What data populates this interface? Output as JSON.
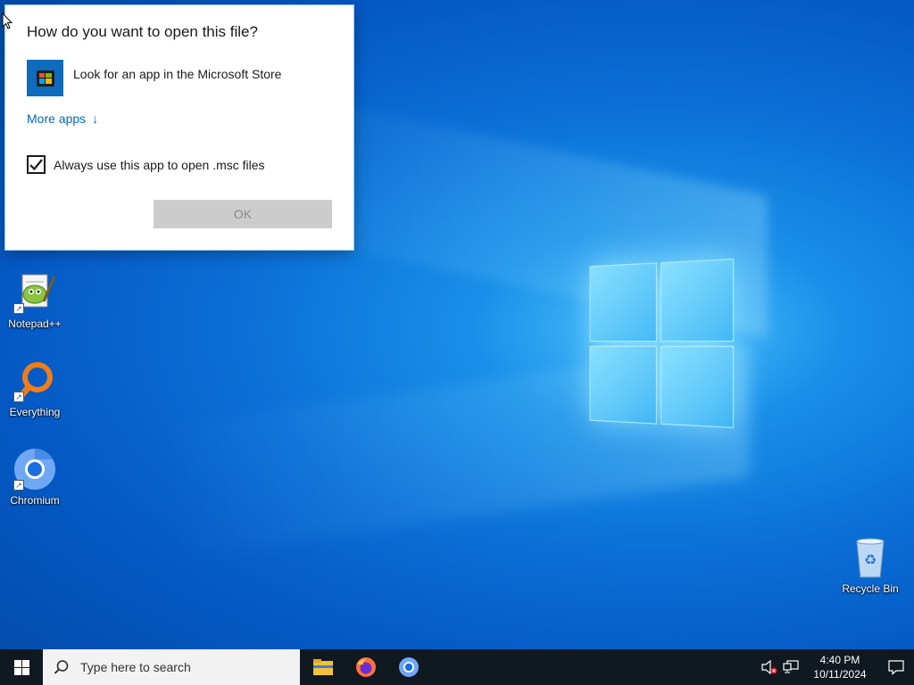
{
  "dialog": {
    "title": "How do you want to open this file?",
    "store_option_label": "Look for an app in the Microsoft Store",
    "more_apps_label": "More apps",
    "more_apps_arrow": "↓",
    "always_use_label": "Always use this app to open .msc files",
    "always_use_checked": true,
    "ok_label": "OK"
  },
  "desktop": {
    "icons": [
      {
        "label": "Notepad++",
        "icon": "notepadpp-icon"
      },
      {
        "label": "Everything",
        "icon": "everything-search-icon"
      },
      {
        "label": "Chromium",
        "icon": "chromium-icon"
      },
      {
        "label": "Recycle Bin",
        "icon": "recycle-bin-icon"
      }
    ]
  },
  "taskbar": {
    "search_placeholder": "Type here to search",
    "pinned": [
      "file-explorer-icon",
      "firefox-icon",
      "chromium-icon"
    ],
    "clock_time": "4:40 PM",
    "clock_date": "10/11/2024"
  },
  "colors": {
    "accent": "#0067c0",
    "taskbar": "#101820",
    "store_tile": "#0f6cbd"
  }
}
